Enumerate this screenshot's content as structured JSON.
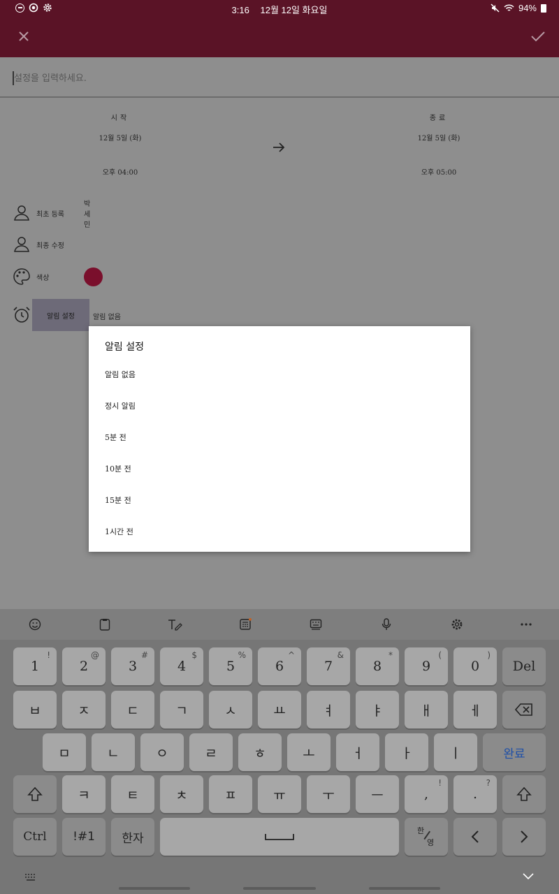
{
  "status_bar": {
    "time": "3:16",
    "date": "12월 12일 화요일",
    "battery": "94%",
    "icons": [
      "dnd-icon",
      "target-icon",
      "gear-icon",
      "mute-icon",
      "wifi-icon",
      "battery-icon"
    ]
  },
  "appbar": {
    "color": "#5a1326",
    "close_icon": "close-icon",
    "confirm_icon": "check-icon"
  },
  "title_input": {
    "placeholder": "설정을 입력하세요.",
    "value": ""
  },
  "start": {
    "label": "시작",
    "date": "12월 5일 (화)",
    "time": "오후 04:00"
  },
  "end": {
    "label": "종료",
    "date": "12월 5일 (화)",
    "time": "오후 05:00"
  },
  "info": {
    "created_label": "최초 등록",
    "created_value": "박세민",
    "modified_label": "최종 수정",
    "color_label": "색상",
    "color_value": "#7a0f2c"
  },
  "alarm": {
    "button_label": "알림 설정",
    "value": "알림 없음"
  },
  "dialog": {
    "title": "알림 설정",
    "options": [
      "알림 없음",
      "정시 알림",
      "5분 전",
      "10분 전",
      "15분 전",
      "1시간 전"
    ]
  },
  "keyboard": {
    "toolbar_icons": [
      "emoji-icon",
      "clipboard-icon",
      "handwriting-icon",
      "keypad-icon",
      "keyboard-icon",
      "mic-icon",
      "gear-icon",
      "more-icon"
    ],
    "row1": [
      {
        "main": "1",
        "sup": "!"
      },
      {
        "main": "2",
        "sup": "@"
      },
      {
        "main": "3",
        "sup": "#"
      },
      {
        "main": "4",
        "sup": "$"
      },
      {
        "main": "5",
        "sup": "%"
      },
      {
        "main": "6",
        "sup": "^"
      },
      {
        "main": "7",
        "sup": "&"
      },
      {
        "main": "8",
        "sup": "*"
      },
      {
        "main": "9",
        "sup": "("
      },
      {
        "main": "0",
        "sup": ")"
      },
      {
        "main": "Del",
        "sup": ""
      }
    ],
    "row2": [
      "ㅂ",
      "ㅈ",
      "ㄷ",
      "ㄱ",
      "ㅅ",
      "ㅛ",
      "ㅕ",
      "ㅑ",
      "ㅐ",
      "ㅔ"
    ],
    "row3": [
      "ㅁ",
      "ㄴ",
      "ㅇ",
      "ㄹ",
      "ㅎ",
      "ㅗ",
      "ㅓ",
      "ㅏ",
      "ㅣ"
    ],
    "done_label": "완료",
    "row4": [
      {
        "main": "ㅋ",
        "sup": ""
      },
      {
        "main": "ㅌ",
        "sup": ""
      },
      {
        "main": "ㅊ",
        "sup": ""
      },
      {
        "main": "ㅍ",
        "sup": ""
      },
      {
        "main": "ㅠ",
        "sup": ""
      },
      {
        "main": "ㅜ",
        "sup": ""
      },
      {
        "main": "ㅡ",
        "sup": ""
      },
      {
        "main": ",",
        "sup": "!"
      },
      {
        "main": ".",
        "sup": "?"
      }
    ],
    "row5": {
      "ctrl": "Ctrl",
      "symbols": "!#1",
      "hanja": "한자",
      "lang_top": "한",
      "lang_bottom": "영"
    }
  }
}
